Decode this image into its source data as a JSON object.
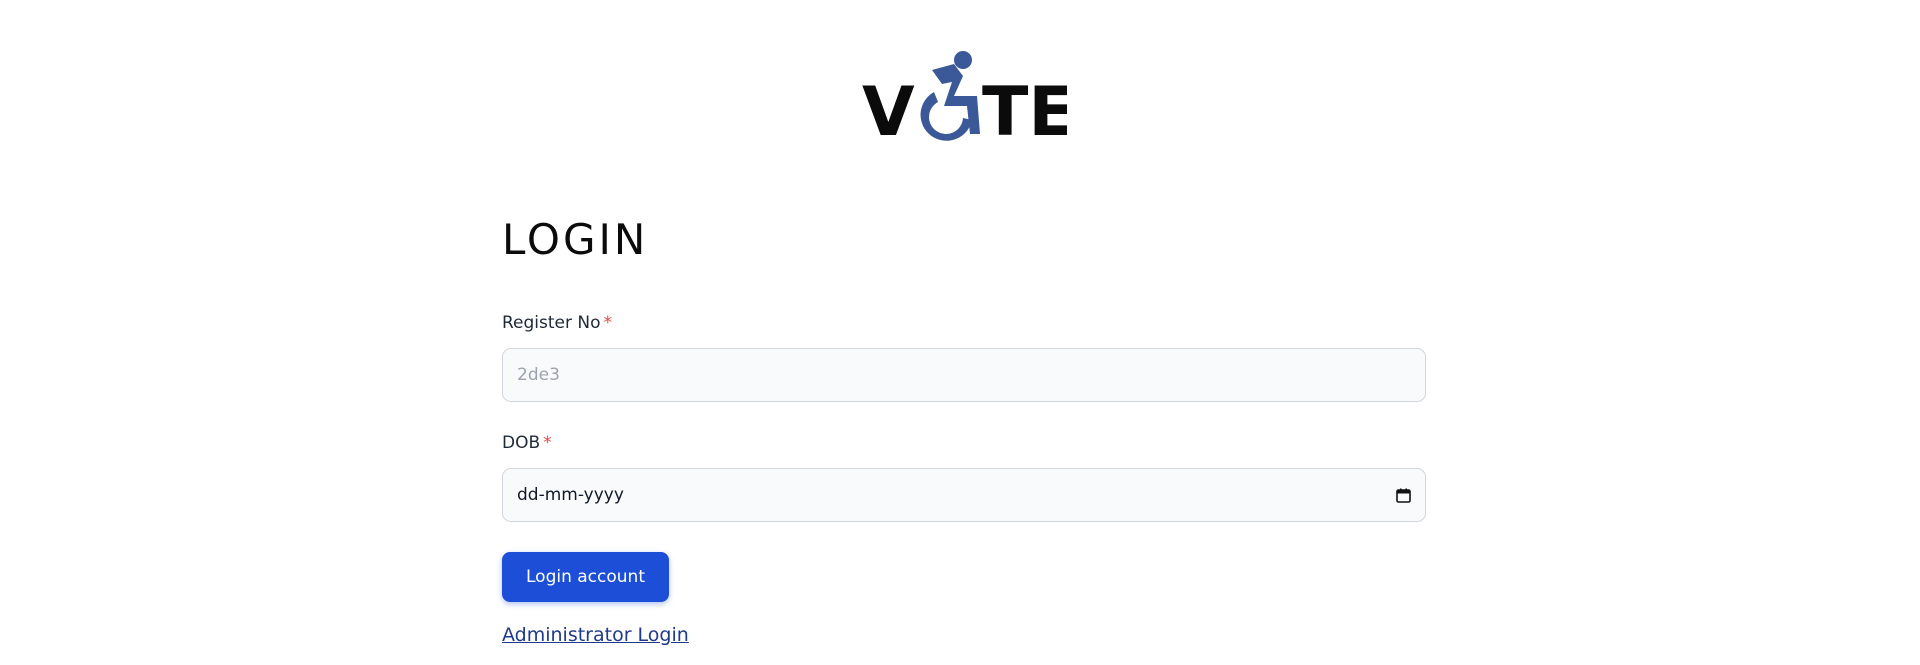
{
  "logo": {
    "text_left": "V",
    "text_right": "TE",
    "icon": "accessible-wheelchair-icon",
    "icon_color": "#3b5998"
  },
  "page": {
    "title": "LOGIN"
  },
  "form": {
    "register_label": "Register No",
    "register_required": "*",
    "register_placeholder": "2de3",
    "dob_label": "DOB",
    "dob_required": "*",
    "dob_value": "dd-mm-yyyy",
    "dob_icon": "calendar-icon",
    "submit_label": "Login account",
    "admin_link_label": "Administrator Login"
  },
  "colors": {
    "accent": "#1d4ed8",
    "required": "#ef4444",
    "link": "#1e3a8a"
  }
}
